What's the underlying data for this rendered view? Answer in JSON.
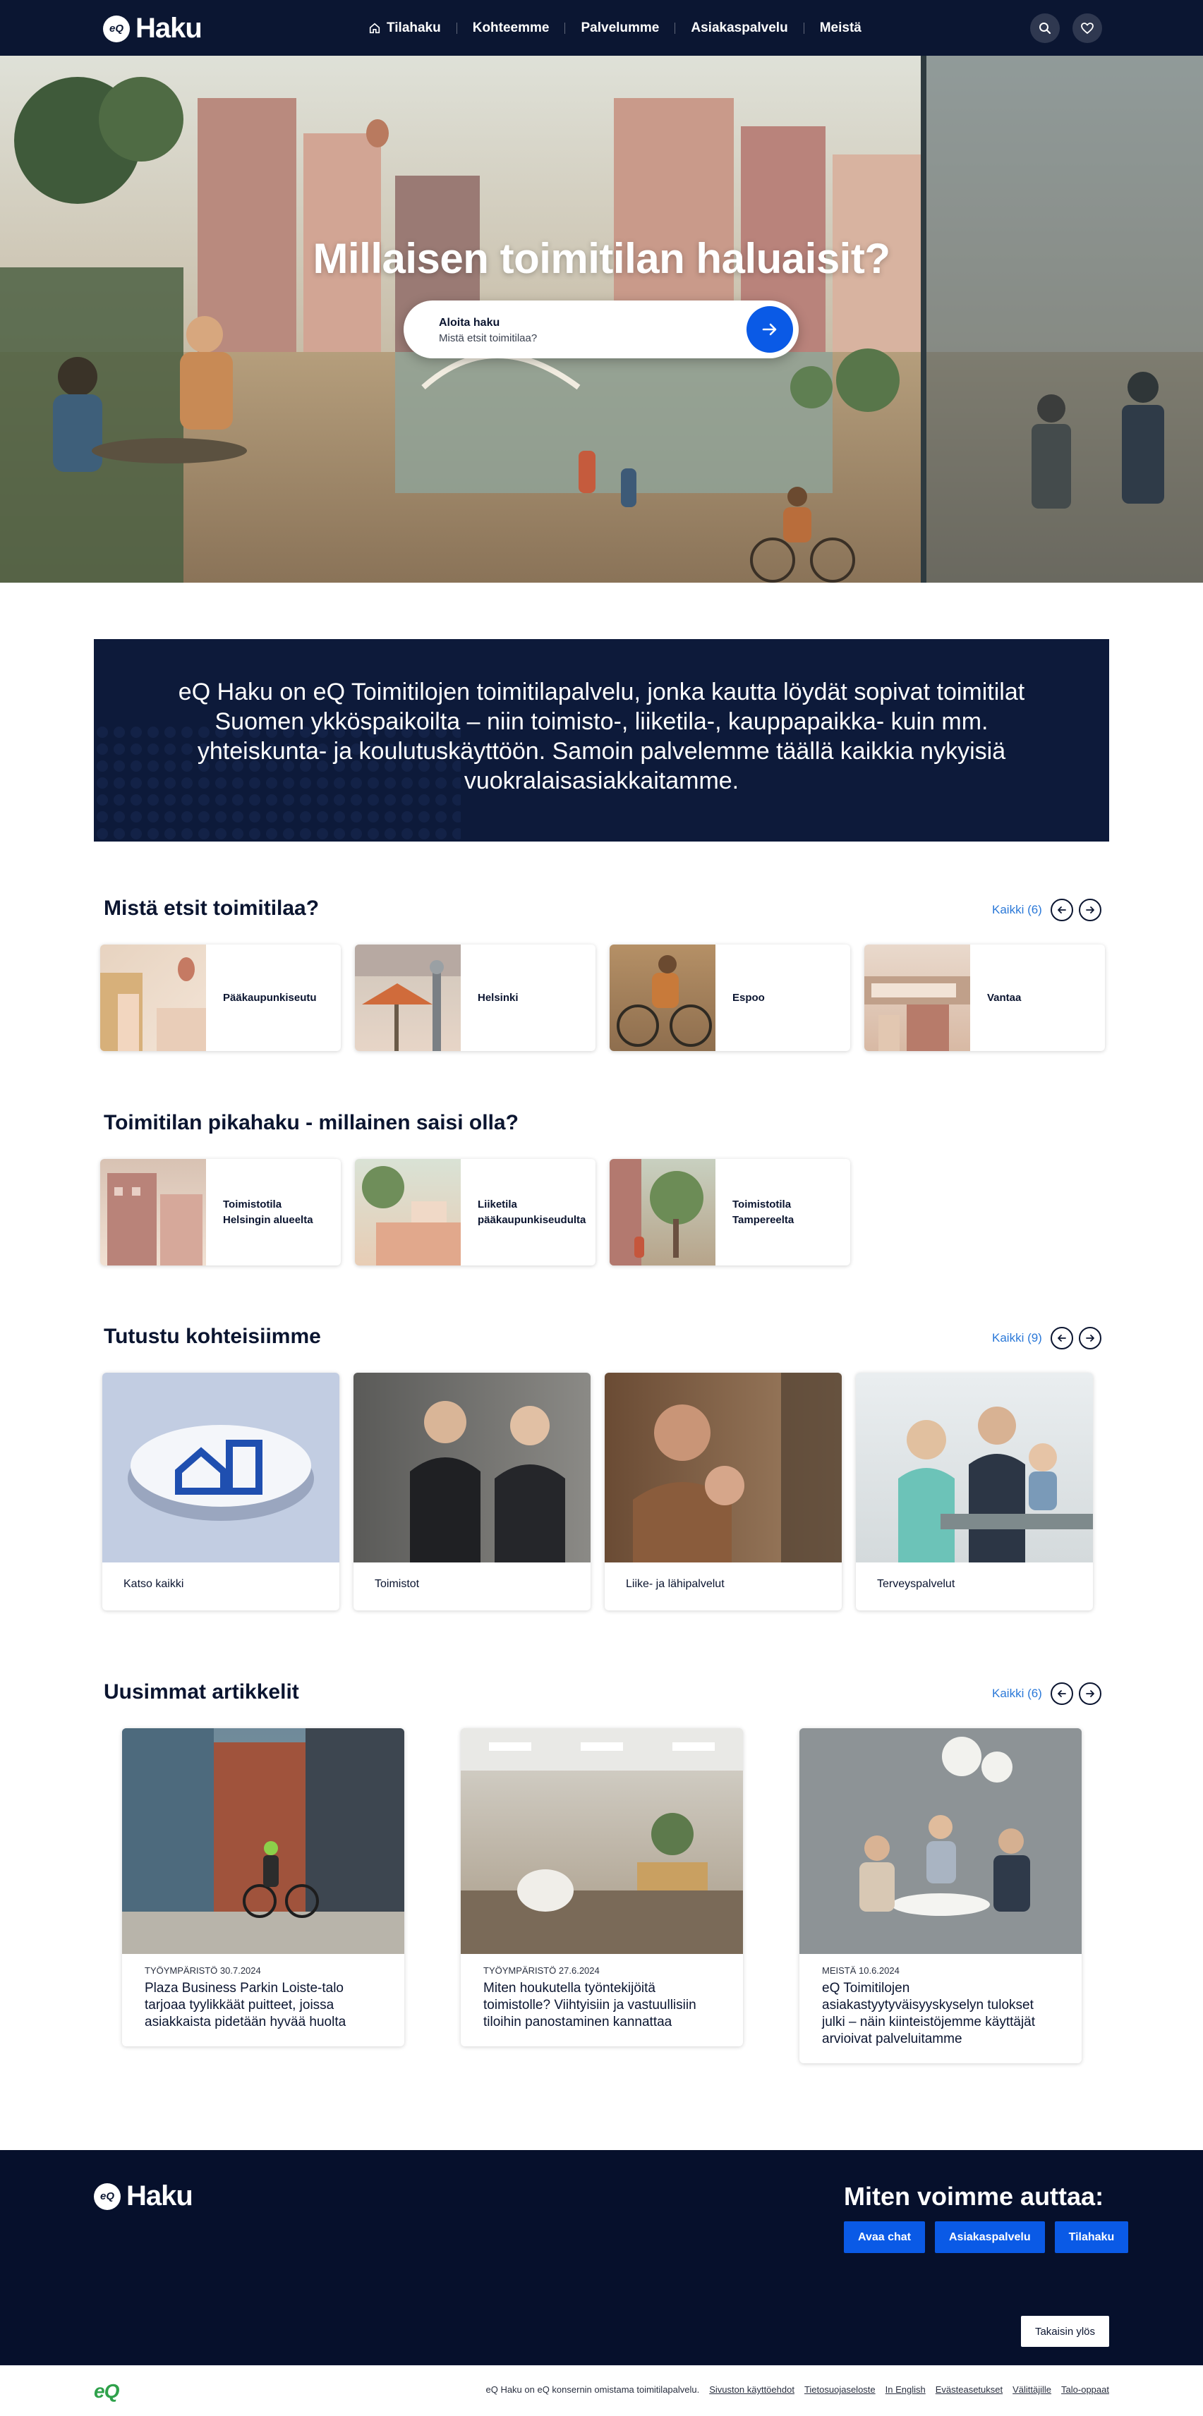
{
  "nav": {
    "logo_badge": "eQ",
    "logo_text": "Haku",
    "links": [
      {
        "label": "Tilahaku",
        "icon": "home-icon"
      },
      {
        "label": "Kohteemme"
      },
      {
        "label": "Palvelumme"
      },
      {
        "label": "Asiakaspalvelu"
      },
      {
        "label": "Meistä"
      }
    ],
    "icons": [
      "search-icon",
      "heart-icon"
    ]
  },
  "hero": {
    "title": "Millaisen toimitilan haluaisit?",
    "search_label": "Aloita haku",
    "search_placeholder": "Mistä etsit toimitilaa?"
  },
  "intro": {
    "text": "eQ Haku on eQ Toimitilojen toimitilapalvelu, jonka kautta löydät sopivat toimitilat Suomen ykköspaikoilta – niin toimisto-, liiketila-, kauppapaikka- kuin mm. yhteiskunta- ja koulutuskäyttöön. Samoin palvelemme täällä kaikkia nykyisiä vuokralaisasiakkaitamme."
  },
  "locations": {
    "title": "Mistä etsit toimitilaa?",
    "all_label": "Kaikki (6)",
    "items": [
      "Pääkaupunkiseutu",
      "Helsinki",
      "Espoo",
      "Vantaa"
    ]
  },
  "quick": {
    "title": "Toimitilan pikahaku - millainen saisi olla?",
    "items": [
      "Toimistotila Helsingin alueelta",
      "Liiketila pääkaupunkiseudulta",
      "Toimistotila Tampereelta"
    ]
  },
  "objects": {
    "title": "Tutustu kohteisiimme",
    "all_label": "Kaikki (9)",
    "items": [
      "Katso kaikki",
      "Toimistot",
      "Liike- ja lähipalvelut",
      "Terveyspalvelut"
    ]
  },
  "articles": {
    "title": "Uusimmat artikkelit",
    "all_label": "Kaikki (6)",
    "items": [
      {
        "meta": "TYÖYMPÄRISTÖ 30.7.2024",
        "title": "Plaza Business Parkin Loiste-talo tarjoaa tyylikkäät puitteet, joissa asiakkaista pidetään hyvää huolta"
      },
      {
        "meta": "TYÖYMPÄRISTÖ 27.6.2024",
        "title": "Miten houkutella työntekijöitä toimistolle? Viihtyisiin ja vastuullisiin tiloihin panostaminen kannattaa"
      },
      {
        "meta": "MEISTÄ 10.6.2024",
        "title": "eQ Toimitilojen asiakastyytyväisyyskyselyn tulokset julki – näin kiinteistöjemme käyttäjät arvioivat palveluitamme"
      }
    ]
  },
  "footer": {
    "help_title": "Miten voimme auttaa:",
    "help_buttons": [
      "Avaa chat",
      "Asiakaspalvelu",
      "Tilahaku"
    ],
    "top_button": "Takaisin ylös",
    "eq_mark": "eQ",
    "owner_text": "eQ Haku on eQ konsernin omistama toimitilapalvelu.",
    "links": [
      "Sivuston käyttöehdot",
      "Tietosuojaseloste",
      "In English",
      "Evästeasetukset",
      "Välittäjille",
      "Talo-oppaat"
    ]
  },
  "colors": {
    "navy": "#0b1632",
    "accent_blue": "#0a5ae6",
    "link_blue": "#2a78d8",
    "footer": "#06102c"
  }
}
